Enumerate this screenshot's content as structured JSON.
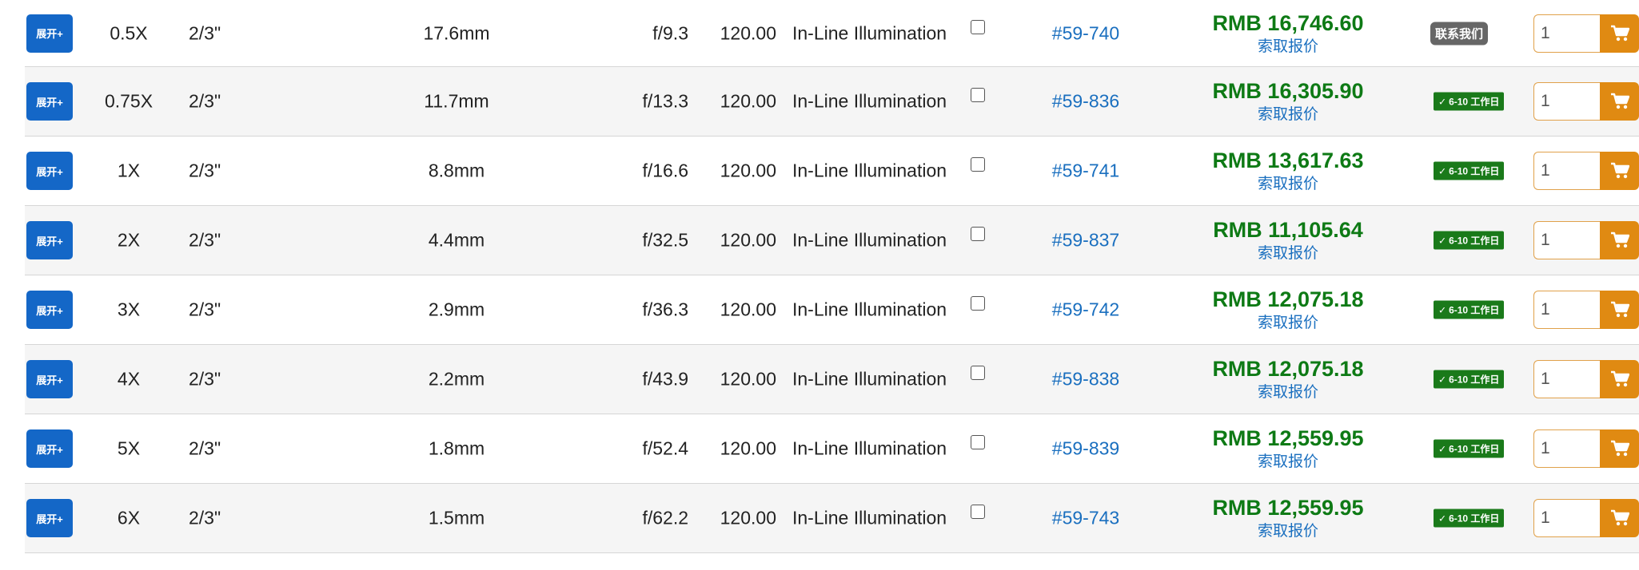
{
  "labels": {
    "expand": "展开+",
    "quote": "索取报价",
    "contact_badge": "联系我们",
    "ship_badge": "6-10 工作日",
    "check_glyph": "✓"
  },
  "colors": {
    "expand_button": "#1467c7",
    "price": "#0e7a15",
    "link": "#1a6fbf",
    "cart_button": "#e08a12",
    "ship_badge": "#1a7a1a",
    "contact_badge": "#666666"
  },
  "icons": [
    "cart-icon",
    "check-icon"
  ],
  "rows": [
    {
      "mag": "0.5X",
      "sensor": "2/3\"",
      "fov": "17.6mm",
      "fnum": "f/9.3",
      "wd": "120.00",
      "illum": "In-Line Illumination",
      "stock": "#59-740",
      "price": "RMB 16,746.60",
      "availability": "contact",
      "qty": "1"
    },
    {
      "mag": "0.75X",
      "sensor": "2/3\"",
      "fov": "11.7mm",
      "fnum": "f/13.3",
      "wd": "120.00",
      "illum": "In-Line Illumination",
      "stock": "#59-836",
      "price": "RMB 16,305.90",
      "availability": "ship",
      "qty": "1"
    },
    {
      "mag": "1X",
      "sensor": "2/3\"",
      "fov": "8.8mm",
      "fnum": "f/16.6",
      "wd": "120.00",
      "illum": "In-Line Illumination",
      "stock": "#59-741",
      "price": "RMB 13,617.63",
      "availability": "ship",
      "qty": "1"
    },
    {
      "mag": "2X",
      "sensor": "2/3\"",
      "fov": "4.4mm",
      "fnum": "f/32.5",
      "wd": "120.00",
      "illum": "In-Line Illumination",
      "stock": "#59-837",
      "price": "RMB 11,105.64",
      "availability": "ship",
      "qty": "1"
    },
    {
      "mag": "3X",
      "sensor": "2/3\"",
      "fov": "2.9mm",
      "fnum": "f/36.3",
      "wd": "120.00",
      "illum": "In-Line Illumination",
      "stock": "#59-742",
      "price": "RMB 12,075.18",
      "availability": "ship",
      "qty": "1"
    },
    {
      "mag": "4X",
      "sensor": "2/3\"",
      "fov": "2.2mm",
      "fnum": "f/43.9",
      "wd": "120.00",
      "illum": "In-Line Illumination",
      "stock": "#59-838",
      "price": "RMB 12,075.18",
      "availability": "ship",
      "qty": "1"
    },
    {
      "mag": "5X",
      "sensor": "2/3\"",
      "fov": "1.8mm",
      "fnum": "f/52.4",
      "wd": "120.00",
      "illum": "In-Line Illumination",
      "stock": "#59-839",
      "price": "RMB 12,559.95",
      "availability": "ship",
      "qty": "1"
    },
    {
      "mag": "6X",
      "sensor": "2/3\"",
      "fov": "1.5mm",
      "fnum": "f/62.2",
      "wd": "120.00",
      "illum": "In-Line Illumination",
      "stock": "#59-743",
      "price": "RMB 12,559.95",
      "availability": "ship",
      "qty": "1"
    }
  ]
}
